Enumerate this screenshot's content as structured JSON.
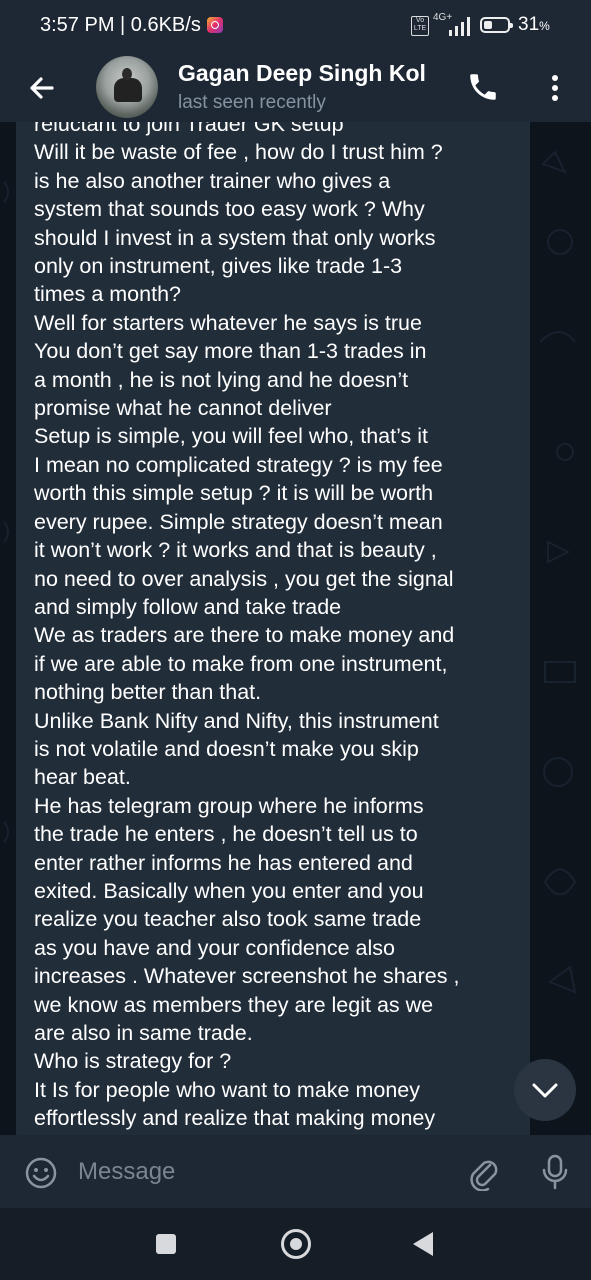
{
  "status_bar": {
    "time_speed": "3:57 PM | 0.6KB/s",
    "volte": "Vo LTE",
    "network": "4G+",
    "battery_value": "31",
    "battery_unit": "%",
    "icons": [
      "instagram-icon",
      "volte-icon",
      "signal-icon",
      "battery-icon"
    ]
  },
  "header": {
    "contact_name": "Gagan Deep Singh Kol",
    "last_seen": "last seen recently",
    "icons": [
      "back-arrow-icon",
      "phone-icon",
      "more-vert-icon"
    ]
  },
  "message": {
    "text": "reluctant to join Trader GK  setup\n Will it be waste of fee , how do I trust him ?\nis he also another  trainer who gives a\nsystem  that sounds too easy  work ? Why\nshould I invest in a system that only works\nonly on instrument, gives like trade 1-3\ntimes a month?\nWell for starters   whatever he says  is true\nYou don’t get say more than 1-3  trades in\na  month ,  he is not  lying  and he doesn’t\npromise what he cannot deliver\nSetup is  simple,  you will feel  who, that’s  it\nI mean  no complicated strategy ? is my fee\nworth  this simple setup ? it is will be worth\nevery rupee. Simple strategy doesn’t mean\nit won’t work ? it works  and that is beauty ,\nno need to over analysis , you get the signal\nand simply follow  and take trade\nWe as traders are there to make money and\nif we are able to make from one instrument,\nnothing  better than that.\nUnlike Bank Nifty and Nifty, this instrument\nis not volatile and doesn’t make you skip\nhear beat.\nHe has telegram group  where he informs\nthe trade  he enters , he doesn’t tell us to\nenter  rather   informs  he has entered  and\nexited. Basically  when you enter  and you\nrealize  you teacher also took same trade\nas you have and your confidence also\nincreases . Whatever screenshot he shares ,\nwe know as members they are legit as we\nare also in same trade.\nWho is strategy for ?\nIt Is for people who want to make money\neffortlessly and realize that making money"
  },
  "scroll_button": {
    "icon": "chevron-down-icon"
  },
  "input_bar": {
    "placeholder": "Message",
    "icons": [
      "emoji-icon",
      "attach-icon",
      "mic-icon"
    ]
  },
  "nav_bar": {
    "icons": [
      "recents-icon",
      "home-icon",
      "back-icon"
    ]
  },
  "colors": {
    "header_bg": "#1e2834",
    "chat_bg": "#0d141c",
    "bubble_bg": "#222d3a",
    "text": "#ffffff",
    "subtext": "#8593a1"
  }
}
